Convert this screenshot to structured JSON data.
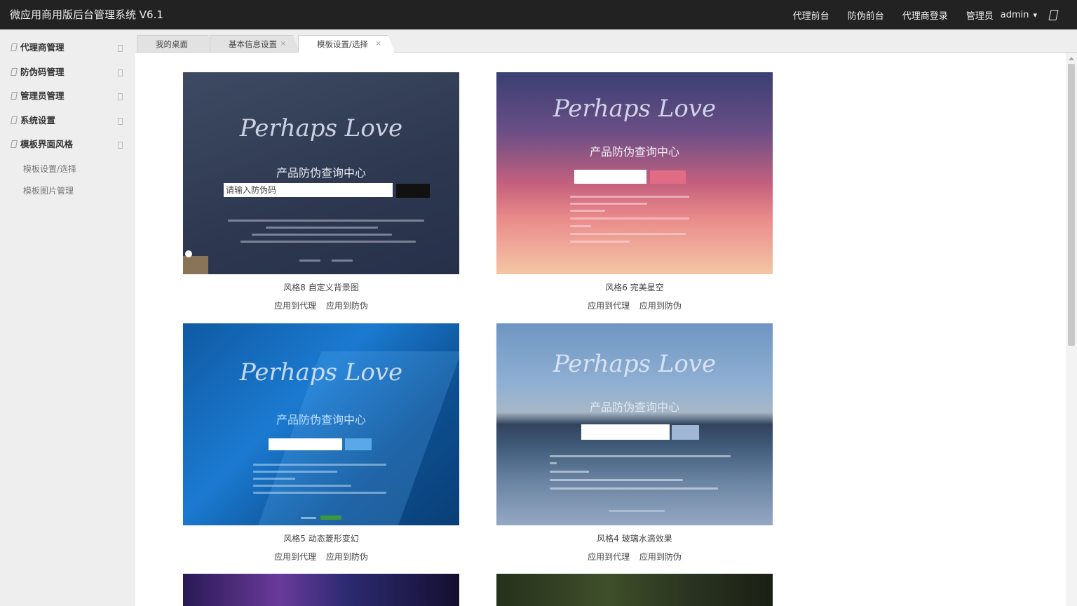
{
  "app": {
    "title": "微应用商用版后台管理系统 V6.1"
  },
  "topbar": {
    "links": [
      "代理前台",
      "防伪前台",
      "代理商登录"
    ],
    "role": "管理员",
    "username": "admin"
  },
  "sidebar": {
    "items": [
      {
        "label": "代理商管理"
      },
      {
        "label": "防伪码管理"
      },
      {
        "label": "管理员管理"
      },
      {
        "label": "系统设置"
      },
      {
        "label": "模板界面风格"
      }
    ],
    "subitems": [
      {
        "label": "模板设置/选择"
      },
      {
        "label": "模板图片管理"
      }
    ]
  },
  "tabs": [
    {
      "label": "我的桌面"
    },
    {
      "label": "基本信息设置"
    },
    {
      "label": "模板设置/选择"
    }
  ],
  "templates": [
    {
      "name": "风格8 自定义背景图",
      "apply_agent": "应用到代理",
      "apply_security": "应用到防伪",
      "preview": {
        "logo": "Perhaps Love",
        "heading": "产品防伪查询中心",
        "placeholder": "请输入防伪码"
      }
    },
    {
      "name": "风格6 完美星空",
      "apply_agent": "应用到代理",
      "apply_security": "应用到防伪",
      "preview": {
        "logo": "Perhaps Love",
        "heading": "产品防伪查询中心"
      }
    },
    {
      "name": "风格5 动态菱形变幻",
      "apply_agent": "应用到代理",
      "apply_security": "应用到防伪",
      "preview": {
        "logo": "Perhaps Love",
        "heading": "产品防伪查询中心"
      }
    },
    {
      "name": "风格4 玻璃水滴效果",
      "apply_agent": "应用到代理",
      "apply_security": "应用到防伪",
      "preview": {
        "logo": "Perhaps Love",
        "heading": "产品防伪查询中心"
      }
    }
  ],
  "colors": {
    "topbar": "#222222",
    "sidebar": "#eeeeee"
  }
}
